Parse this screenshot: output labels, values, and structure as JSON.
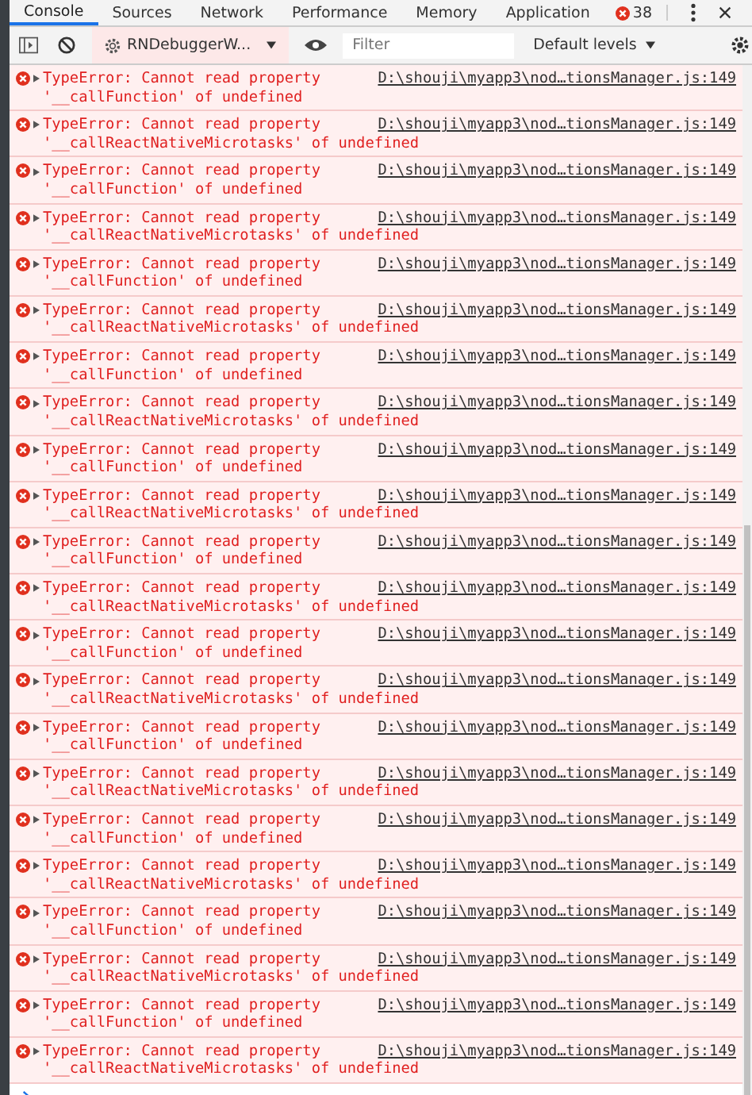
{
  "tabs": [
    {
      "label": "Console",
      "selected": true
    },
    {
      "label": "Sources",
      "selected": false
    },
    {
      "label": "Network",
      "selected": false
    },
    {
      "label": "Performance",
      "selected": false
    },
    {
      "label": "Memory",
      "selected": false
    },
    {
      "label": "Application",
      "selected": false
    }
  ],
  "error_count": "38",
  "toolbar": {
    "context": "RNDebuggerW...",
    "filter": {
      "placeholder": "Filter"
    },
    "levels": "Default levels"
  },
  "messages": [
    {
      "text": "TypeError: Cannot read property",
      "link": "D:\\shouji\\myapp3\\nod…tionsManager.js:149",
      "detail": "'__callFunction' of undefined"
    },
    {
      "text": "TypeError: Cannot read property",
      "link": "D:\\shouji\\myapp3\\nod…tionsManager.js:149",
      "detail": "'__callReactNativeMicrotasks' of undefined"
    },
    {
      "text": "TypeError: Cannot read property",
      "link": "D:\\shouji\\myapp3\\nod…tionsManager.js:149",
      "detail": "'__callFunction' of undefined"
    },
    {
      "text": "TypeError: Cannot read property",
      "link": "D:\\shouji\\myapp3\\nod…tionsManager.js:149",
      "detail": "'__callReactNativeMicrotasks' of undefined"
    },
    {
      "text": "TypeError: Cannot read property",
      "link": "D:\\shouji\\myapp3\\nod…tionsManager.js:149",
      "detail": "'__callFunction' of undefined"
    },
    {
      "text": "TypeError: Cannot read property",
      "link": "D:\\shouji\\myapp3\\nod…tionsManager.js:149",
      "detail": "'__callReactNativeMicrotasks' of undefined"
    },
    {
      "text": "TypeError: Cannot read property",
      "link": "D:\\shouji\\myapp3\\nod…tionsManager.js:149",
      "detail": "'__callFunction' of undefined"
    },
    {
      "text": "TypeError: Cannot read property",
      "link": "D:\\shouji\\myapp3\\nod…tionsManager.js:149",
      "detail": "'__callReactNativeMicrotasks' of undefined"
    },
    {
      "text": "TypeError: Cannot read property",
      "link": "D:\\shouji\\myapp3\\nod…tionsManager.js:149",
      "detail": "'__callFunction' of undefined"
    },
    {
      "text": "TypeError: Cannot read property",
      "link": "D:\\shouji\\myapp3\\nod…tionsManager.js:149",
      "detail": "'__callReactNativeMicrotasks' of undefined"
    },
    {
      "text": "TypeError: Cannot read property",
      "link": "D:\\shouji\\myapp3\\nod…tionsManager.js:149",
      "detail": "'__callFunction' of undefined"
    },
    {
      "text": "TypeError: Cannot read property",
      "link": "D:\\shouji\\myapp3\\nod…tionsManager.js:149",
      "detail": "'__callReactNativeMicrotasks' of undefined"
    },
    {
      "text": "TypeError: Cannot read property",
      "link": "D:\\shouji\\myapp3\\nod…tionsManager.js:149",
      "detail": "'__callFunction' of undefined"
    },
    {
      "text": "TypeError: Cannot read property",
      "link": "D:\\shouji\\myapp3\\nod…tionsManager.js:149",
      "detail": "'__callReactNativeMicrotasks' of undefined"
    },
    {
      "text": "TypeError: Cannot read property",
      "link": "D:\\shouji\\myapp3\\nod…tionsManager.js:149",
      "detail": "'__callFunction' of undefined"
    },
    {
      "text": "TypeError: Cannot read property",
      "link": "D:\\shouji\\myapp3\\nod…tionsManager.js:149",
      "detail": "'__callReactNativeMicrotasks' of undefined"
    },
    {
      "text": "TypeError: Cannot read property",
      "link": "D:\\shouji\\myapp3\\nod…tionsManager.js:149",
      "detail": "'__callFunction' of undefined"
    },
    {
      "text": "TypeError: Cannot read property",
      "link": "D:\\shouji\\myapp3\\nod…tionsManager.js:149",
      "detail": "'__callReactNativeMicrotasks' of undefined"
    },
    {
      "text": "TypeError: Cannot read property",
      "link": "D:\\shouji\\myapp3\\nod…tionsManager.js:149",
      "detail": "'__callFunction' of undefined"
    },
    {
      "text": "TypeError: Cannot read property",
      "link": "D:\\shouji\\myapp3\\nod…tionsManager.js:149",
      "detail": "'__callReactNativeMicrotasks' of undefined"
    },
    {
      "text": "TypeError: Cannot read property",
      "link": "D:\\shouji\\myapp3\\nod…tionsManager.js:149",
      "detail": "'__callFunction' of undefined"
    },
    {
      "text": "TypeError: Cannot read property",
      "link": "D:\\shouji\\myapp3\\nod…tionsManager.js:149",
      "detail": "'__callReactNativeMicrotasks' of undefined"
    }
  ]
}
